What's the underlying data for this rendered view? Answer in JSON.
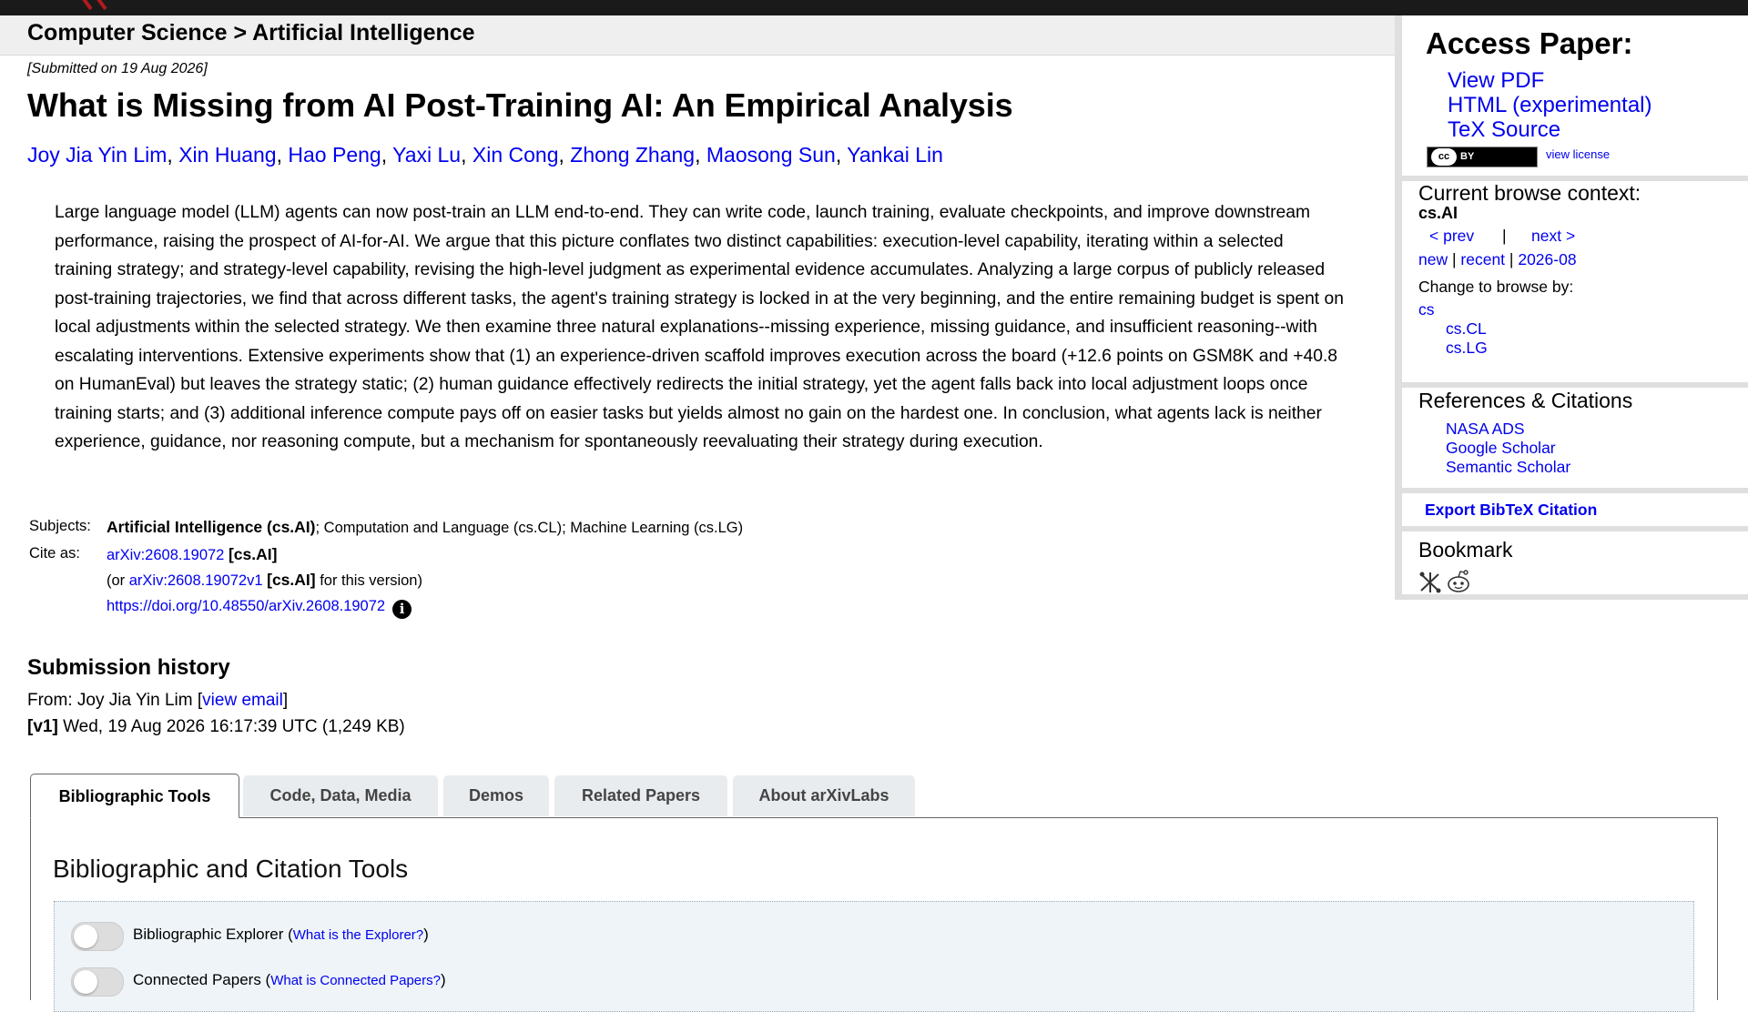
{
  "breadcrumb": {
    "text": "Computer Science > Artificial Intelligence"
  },
  "submitted": "[Submitted on 19 Aug 2026]",
  "title": "What is Missing from AI Post-Training AI: An Empirical Analysis",
  "authors": [
    "Joy Jia Yin Lim",
    "Xin Huang",
    "Hao Peng",
    "Yaxi Lu",
    "Xin Cong",
    "Zhong Zhang",
    "Maosong Sun",
    "Yankai Lin"
  ],
  "author_sep": ", ",
  "abstract": "Large language model (LLM) agents can now post-train an LLM end-to-end. They can write code, launch training, evaluate checkpoints, and improve downstream performance, raising the prospect of AI-for-AI. We argue that this picture conflates two distinct capabilities: execution-level capability, iterating within a selected training strategy; and strategy-level capability, revising the high-level judgment as experimental evidence accumulates. Analyzing a large corpus of publicly released post-training trajectories, we find that across different tasks, the agent's training strategy is locked in at the very beginning, and the entire remaining budget is spent on local adjustments within the selected strategy. We then examine three natural explanations--missing experience, missing guidance, and insufficient reasoning--with escalating interventions. Extensive experiments show that (1) an experience-driven scaffold improves execution across the board (+12.6 points on GSM8K and +40.8 on HumanEval) but leaves the strategy static; (2) human guidance effectively redirects the initial strategy, yet the agent falls back into local adjustment loops once training starts; and (3) additional inference compute pays off on easier tasks but yields almost no gain on the hardest one. In conclusion, what agents lack is neither experience, guidance, nor reasoning compute, but a mechanism for spontaneously reevaluating their strategy during execution.",
  "meta": {
    "subjects_label": "Subjects:",
    "subjects_primary": "Artificial Intelligence (cs.AI)",
    "subjects_rest": "; Computation and Language (cs.CL); Machine Learning (cs.LG)",
    "cite_label": "Cite as:",
    "cite_id": "arXiv:2608.19072",
    "cite_cat": "[cs.AI]",
    "cite_or_prefix": "(or ",
    "cite_version_id": "arXiv:2608.19072v1",
    "cite_version_cat": "[cs.AI]",
    "cite_or_suffix": " for this version)",
    "doi": "https://doi.org/10.48550/arXiv.2608.19072",
    "info_glyph": "i"
  },
  "history": {
    "title": "Submission history",
    "from_prefix": "From: Joy Jia Yin Lim [",
    "view_email": "view email",
    "from_suffix": "]",
    "v1_tag": "[v1]",
    "v1_text": " Wed, 19 Aug 2026 16:17:39 UTC (1,249 KB)"
  },
  "tabs": [
    "Bibliographic Tools",
    "Code, Data, Media",
    "Demos",
    "Related Papers",
    "About arXivLabs"
  ],
  "panel": {
    "title": "Bibliographic and Citation Tools",
    "tools": [
      {
        "label": "Bibliographic Explorer (",
        "link": "What is the Explorer?",
        "suffix": ")"
      },
      {
        "label": "Connected Papers (",
        "link": "What is Connected Papers?",
        "suffix": ")"
      }
    ]
  },
  "sidebar": {
    "access_title": "Access Paper:",
    "access_links": [
      "View PDF",
      "HTML (experimental)",
      "TeX Source"
    ],
    "license_link": "view license",
    "cc_text": "cc",
    "by_text": "BY",
    "browse_title": "Current browse context:",
    "browse_context": "cs.AI",
    "prev": "< prev",
    "sep": "|",
    "next": "next >",
    "new": "new",
    "recent": "recent",
    "month": "2026-08",
    "change_label": "Change to browse by:",
    "browse_by": [
      "cs",
      "cs.CL",
      "cs.LG"
    ],
    "refs_title": "References & Citations",
    "refs_links": [
      "NASA ADS",
      "Google Scholar",
      "Semantic Scholar"
    ],
    "export": "Export BibTeX Citation",
    "bookmark_title": "Bookmark"
  },
  "colors": {
    "link": "#0000ee",
    "topbar": "#1a1a1a",
    "accent_logo": "#b31b1b",
    "sidebar_bg": "#dfdfdf",
    "panel_bg": "#eef4f8"
  }
}
